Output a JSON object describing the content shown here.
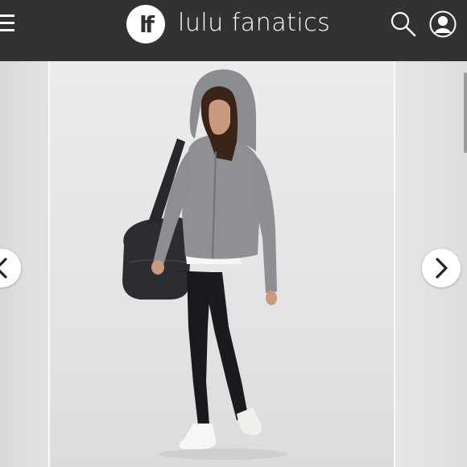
{
  "header": {
    "logo_text": "lf",
    "brand_name": "lulu fanatics",
    "menu_icon": "hamburger-menu-icon",
    "search_icon": "search-icon",
    "account_icon": "user-account-icon"
  },
  "carousel": {
    "prev_icon": "chevron-left-icon",
    "next_icon": "chevron-right-icon",
    "main_image": "model-wearing-grey-zip-hoodie-black-leggings-white-sneakers-holding-black-duffel-bag"
  },
  "colors": {
    "header_bg": "#323232",
    "header_text": "#ffffff",
    "photo_bg": "#e6e6e6"
  }
}
